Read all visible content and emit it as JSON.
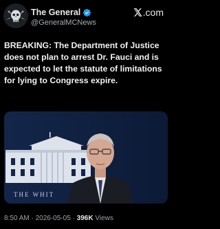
{
  "account": {
    "display_name": "The General",
    "handle": "@GeneralMCNews",
    "avatar_icon": "skull-crest-avatar",
    "verified_icon": "verified-badge-icon",
    "verified_color": "#1d9bf0"
  },
  "brand": {
    "icon": "x-logo-icon",
    "label": ".com"
  },
  "tweet": {
    "text": "BREAKING: The Department of Justice does not plan to arrest Dr. Fauci and is expected to let the statute of limitations for lying to Congress expire."
  },
  "media": {
    "caption_text": "THE WHIT",
    "background_color": "#0f1f3d"
  },
  "meta": {
    "time": "8:50 AM",
    "separator": "·",
    "date": "2026-05-05",
    "views_count": "396K",
    "views_label": "Views"
  }
}
